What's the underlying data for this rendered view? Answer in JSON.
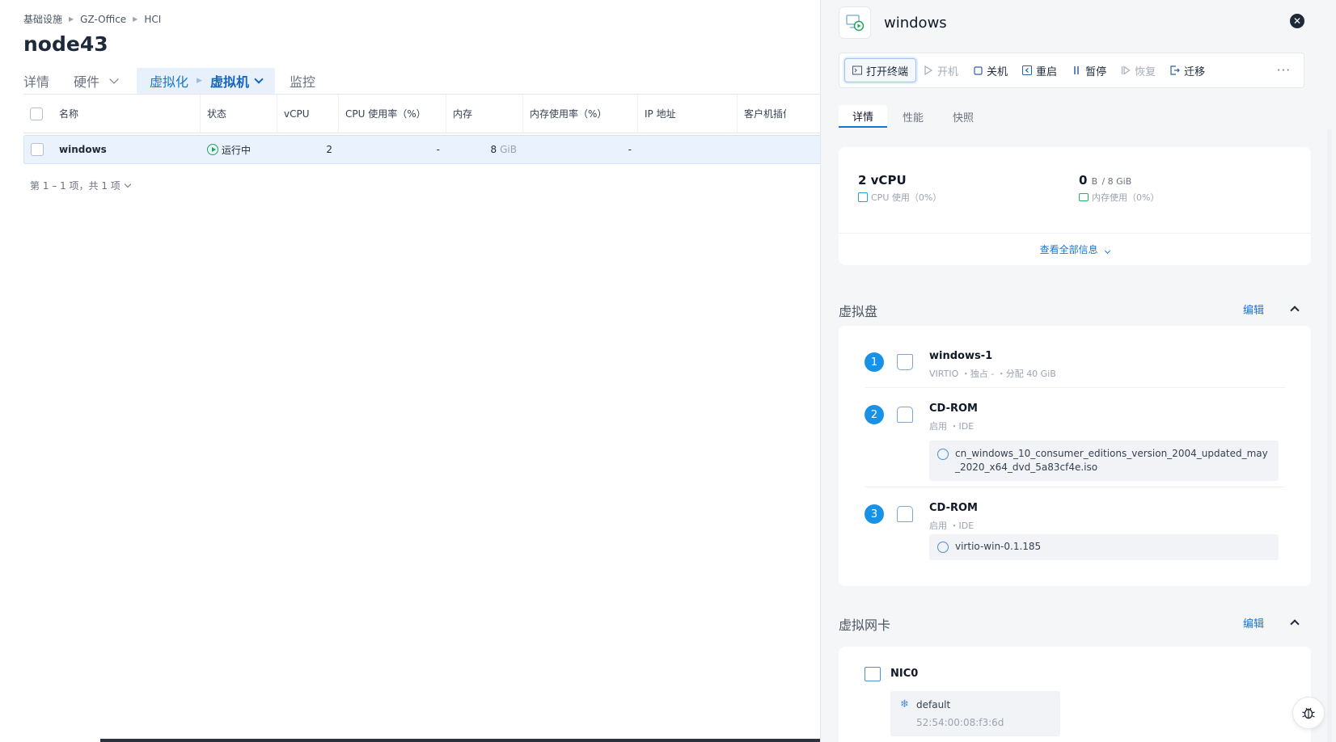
{
  "breadcrumb": [
    "基础设施",
    "GZ-Office",
    "HCI"
  ],
  "page_title": "node43",
  "tabs": {
    "details": "详情",
    "hardware": "硬件",
    "virtualization": "虚拟化",
    "vms": "虚拟机",
    "monitor": "监控"
  },
  "table": {
    "headers": [
      "名称",
      "状态",
      "vCPU",
      "CPU 使用率（%）",
      "内存",
      "内存使用率（%）",
      "IP 地址",
      "客户机插件"
    ],
    "row": {
      "name": "windows",
      "status": "运行中",
      "vcpu": "2",
      "cpu_usage": "-",
      "memory_value": "8",
      "memory_unit": "GiB",
      "memory_usage": "-",
      "ip": ""
    },
    "pagination": "第 1 – 1 项，共 1 项"
  },
  "drawer": {
    "title": "windows",
    "toolbar": {
      "open_terminal": "打开终端",
      "power_on": "开机",
      "shutdown": "关机",
      "restart": "重启",
      "pause": "暂停",
      "resume": "恢复",
      "migrate": "迁移",
      "more": "···"
    },
    "tabs": [
      "详情",
      "性能",
      "快照"
    ],
    "summary": {
      "cpu_big": "2 vCPU",
      "cpu_sub": "CPU 使用（0%）",
      "mem_used": "0",
      "mem_unit": "B",
      "mem_total": "/ 8 GiB",
      "mem_sub": "内存使用（0%）",
      "view_all": "查看全部信息"
    },
    "disks_section": {
      "title": "虚拟盘",
      "edit": "编辑"
    },
    "disks": [
      {
        "index": "1",
        "name": "windows-1",
        "meta": "VIRTIO ・独占 - ・分配 40 GiB",
        "iso": ""
      },
      {
        "index": "2",
        "name": "CD-ROM",
        "meta": "启用 ・IDE",
        "iso": "cn_windows_10_consumer_editions_version_2004_updated_may_2020_x64_dvd_5a83cf4e.iso"
      },
      {
        "index": "3",
        "name": "CD-ROM",
        "meta": "启用 ・IDE",
        "iso": "virtio-win-0.1.185"
      }
    ],
    "nics_section": {
      "title": "虚拟网卡",
      "edit": "编辑"
    },
    "nic": {
      "name": "NIC0",
      "network": "default",
      "mac": "52:54:00:08:f3:6d"
    }
  }
}
